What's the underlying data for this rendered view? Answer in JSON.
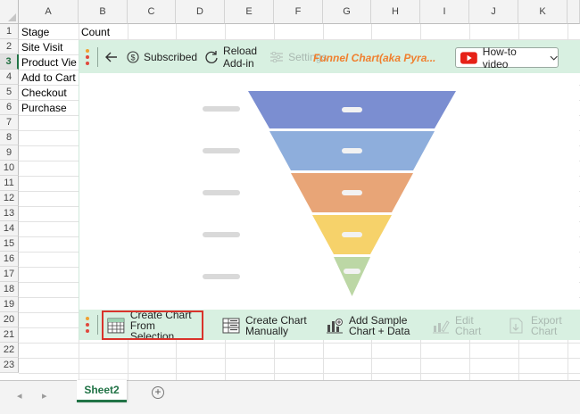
{
  "columns": [
    "A",
    "B",
    "C",
    "D",
    "E",
    "F",
    "G",
    "H",
    "I",
    "J",
    "K"
  ],
  "rows": [
    "1",
    "2",
    "3",
    "4",
    "5",
    "6",
    "7",
    "8",
    "9",
    "10",
    "11",
    "12",
    "13",
    "14",
    "15",
    "16",
    "17",
    "18",
    "19",
    "20",
    "21",
    "22",
    "23"
  ],
  "selected_row": "3",
  "cells": {
    "a1": "Stage",
    "b1": "Count",
    "a2": "Site Visit",
    "a3": "Product Vie",
    "a4": "Add to Cart",
    "a5": "Checkout",
    "a6": "Purchase"
  },
  "addin": {
    "toolbar": {
      "subscribed": "Subscribed",
      "reload_line1": "Reload",
      "reload_line2": "Add-in",
      "settings": "Settings",
      "brand": "Funnel Chart(aka Pyra...",
      "howto": "How-to video",
      "dot_colors": [
        "#f0a030",
        "#e0483c"
      ]
    },
    "bottom": {
      "create_from_sel_1": "Create Chart",
      "create_from_sel_2": "From Selection",
      "create_manual_1": "Create Chart",
      "create_manual_2": "Manually",
      "add_sample_1": "Add Sample",
      "add_sample_2": "Chart + Data",
      "edit_1": "Edit",
      "edit_2": "Chart",
      "export_1": "Export",
      "export_2": "Chart"
    },
    "funnel_colors": [
      "#7b8ed1",
      "#8eaedc",
      "#e8a577",
      "#f6d26a",
      "#bcd7a5"
    ]
  },
  "tabs": {
    "sheet": "Sheet2",
    "add": "+"
  }
}
